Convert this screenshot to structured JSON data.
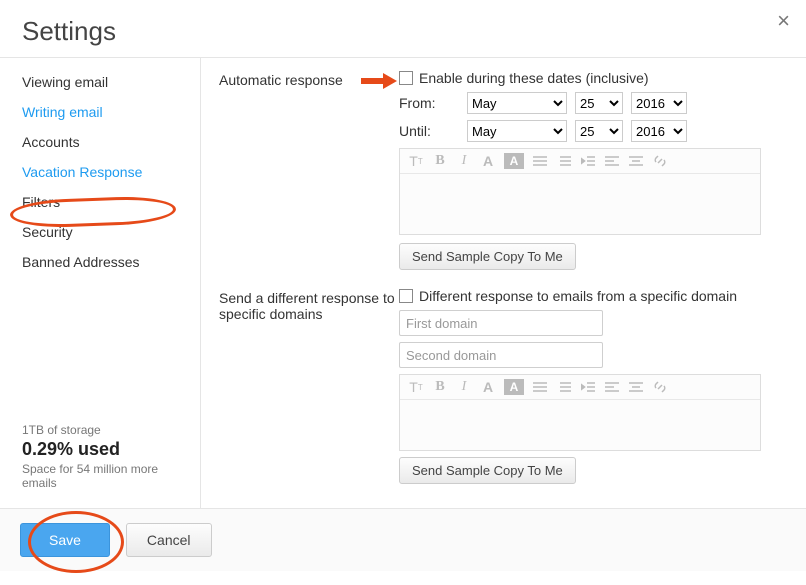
{
  "title": "Settings",
  "sidebar": {
    "items": [
      {
        "label": "Viewing email"
      },
      {
        "label": "Writing email"
      },
      {
        "label": "Accounts"
      },
      {
        "label": "Vacation Response"
      },
      {
        "label": "Filters"
      },
      {
        "label": "Security"
      },
      {
        "label": "Banned Addresses"
      }
    ],
    "active_index": 3
  },
  "storage": {
    "capacity": "1TB of storage",
    "used": "0.29% used",
    "detail": "Space for 54 million more emails"
  },
  "auto_response": {
    "section_label": "Automatic response",
    "enable_label": "Enable during these dates (inclusive)",
    "from_label": "From:",
    "until_label": "Until:",
    "month_options": [
      "May"
    ],
    "day_options": [
      "25"
    ],
    "year_options": [
      "2016"
    ],
    "from": {
      "month": "May",
      "day": "25",
      "year": "2016"
    },
    "until": {
      "month": "May",
      "day": "25",
      "year": "2016"
    },
    "sample_btn": "Send Sample Copy To Me"
  },
  "domain_response": {
    "section_label": "Send a different response to specific domains",
    "checkbox_label": "Different response to emails from a specific domain",
    "domain1_placeholder": "First domain",
    "domain2_placeholder": "Second domain",
    "sample_btn": "Send Sample Copy To Me"
  },
  "footer": {
    "save": "Save",
    "cancel": "Cancel"
  },
  "annotations": {
    "sidebar_circle": true,
    "arrow": true,
    "save_circle": true
  }
}
